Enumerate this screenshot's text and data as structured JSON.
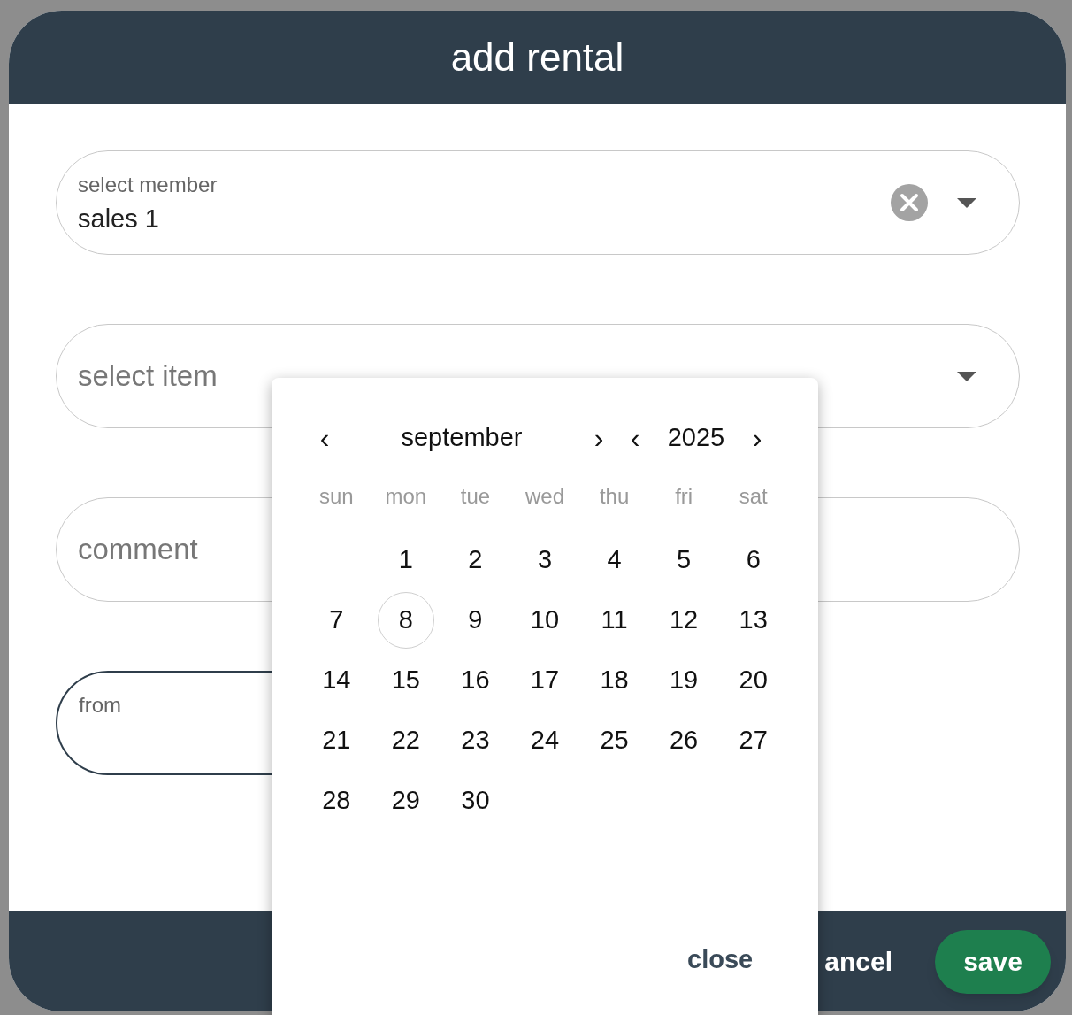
{
  "dialog": {
    "title": "add rental"
  },
  "fields": [
    {
      "kind": "select",
      "label": "select member",
      "value": "sales 1",
      "clearable": true,
      "focused": false
    },
    {
      "kind": "select",
      "placeholder": "select item",
      "focused": false
    },
    {
      "kind": "text",
      "placeholder": "comment",
      "focused": false
    },
    {
      "kind": "date",
      "label": "from",
      "focused": true
    }
  ],
  "calendar": {
    "month": "september",
    "year": "2025",
    "prev_month": "‹",
    "next_month": "›",
    "prev_year": "‹",
    "next_year": "›",
    "weekdays": [
      "sun",
      "mon",
      "tue",
      "wed",
      "thu",
      "fri",
      "sat"
    ],
    "weeks": [
      {
        "days": [
          {
            "label": "1",
            "selected": false
          },
          {
            "label": "2",
            "selected": false
          },
          {
            "label": "3",
            "selected": false
          },
          {
            "label": "4",
            "selected": false
          },
          {
            "label": "5",
            "selected": false
          },
          {
            "label": "6",
            "selected": false
          }
        ]
      },
      {
        "days": [
          {
            "label": "7",
            "selected": false
          },
          {
            "label": "8",
            "selected": true
          },
          {
            "label": "9",
            "selected": false
          },
          {
            "label": "10",
            "selected": false
          },
          {
            "label": "11",
            "selected": false
          },
          {
            "label": "12",
            "selected": false
          },
          {
            "label": "13",
            "selected": false
          }
        ]
      },
      {
        "days": [
          {
            "label": "14",
            "selected": false
          },
          {
            "label": "15",
            "selected": false
          },
          {
            "label": "16",
            "selected": false
          },
          {
            "label": "17",
            "selected": false
          },
          {
            "label": "18",
            "selected": false
          },
          {
            "label": "19",
            "selected": false
          },
          {
            "label": "20",
            "selected": false
          }
        ]
      },
      {
        "days": [
          {
            "label": "21",
            "selected": false
          },
          {
            "label": "22",
            "selected": false
          },
          {
            "label": "23",
            "selected": false
          },
          {
            "label": "24",
            "selected": false
          },
          {
            "label": "25",
            "selected": false
          },
          {
            "label": "26",
            "selected": false
          },
          {
            "label": "27",
            "selected": false
          }
        ]
      },
      {
        "days": [
          {
            "label": "28",
            "selected": false
          },
          {
            "label": "29",
            "selected": false
          },
          {
            "label": "30",
            "selected": false
          }
        ]
      }
    ],
    "close": "close"
  },
  "footer": {
    "cancel": "ancel",
    "save": "save"
  }
}
